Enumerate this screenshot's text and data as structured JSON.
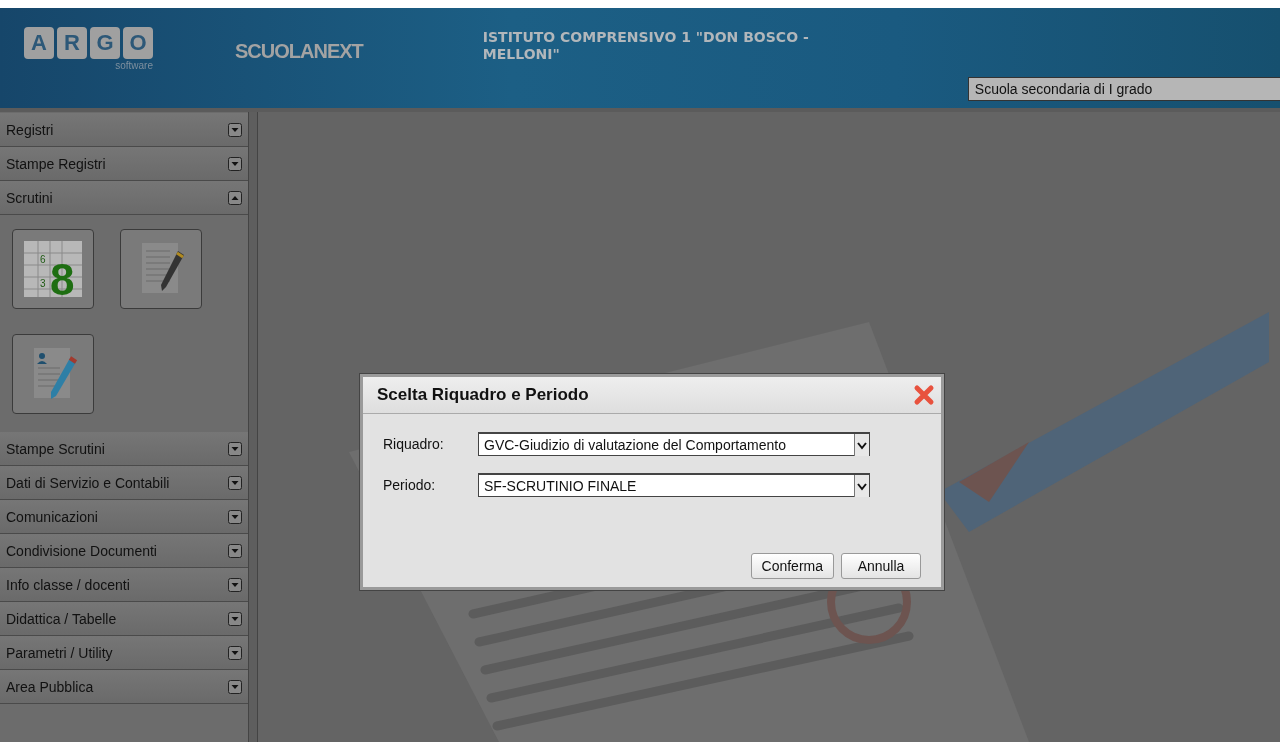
{
  "header": {
    "logo_letters": [
      "A",
      "R",
      "G",
      "O"
    ],
    "logo_subtitle": "software",
    "product": "SCUOLANEXT",
    "school": "ISTITUTO COMPRENSIVO 1 \"DON BOSCO - MELLONI\"",
    "school_level": "Scuola secondaria di I grado"
  },
  "sidebar": {
    "grades_icon": {
      "small_digits": [
        "6",
        "3"
      ],
      "large_digit": "8"
    },
    "items": [
      {
        "label": "Registri",
        "expanded": false
      },
      {
        "label": "Stampe Registri",
        "expanded": false
      },
      {
        "label": "Scrutini",
        "expanded": true
      },
      {
        "label": "Stampe Scrutini",
        "expanded": false
      },
      {
        "label": "Dati di Servizio e Contabili",
        "expanded": false
      },
      {
        "label": "Comunicazioni",
        "expanded": false
      },
      {
        "label": "Condivisione Documenti",
        "expanded": false
      },
      {
        "label": "Info classe / docenti",
        "expanded": false
      },
      {
        "label": "Didattica / Tabelle",
        "expanded": false
      },
      {
        "label": "Parametri / Utility",
        "expanded": false
      },
      {
        "label": "Area Pubblica",
        "expanded": false
      }
    ]
  },
  "dialog": {
    "title": "Scelta Riquadro e Periodo",
    "fields": [
      {
        "label": "Riquadro:",
        "value": "GVC-Giudizio di valutazione del Comportamento"
      },
      {
        "label": "Periodo:",
        "value": "SF-SCRUTINIO FINALE"
      }
    ],
    "buttons": [
      "Conferma",
      "Annulla"
    ]
  }
}
